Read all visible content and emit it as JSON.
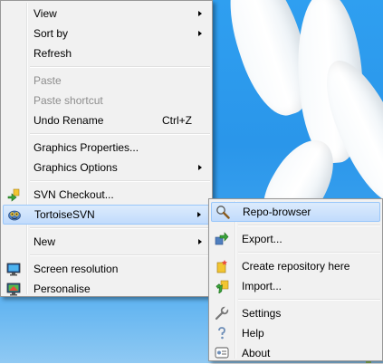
{
  "context_menu": {
    "items": [
      {
        "label": "View",
        "submenu": true
      },
      {
        "label": "Sort by",
        "submenu": true
      },
      {
        "label": "Refresh"
      },
      {
        "label": "Paste",
        "disabled": true
      },
      {
        "label": "Paste shortcut",
        "disabled": true
      },
      {
        "label": "Undo Rename",
        "shortcut": "Ctrl+Z"
      },
      {
        "label": "Graphics Properties..."
      },
      {
        "label": "Graphics Options",
        "submenu": true
      },
      {
        "label": "SVN Checkout...",
        "icon": "svn-checkout-icon"
      },
      {
        "label": "TortoiseSVN",
        "icon": "tortoisesvn-icon",
        "submenu": true,
        "highlighted": true
      },
      {
        "label": "New",
        "submenu": true
      },
      {
        "label": "Screen resolution",
        "icon": "screen-resolution-icon"
      },
      {
        "label": "Personalise",
        "icon": "personalise-icon"
      }
    ]
  },
  "tortoisesvn_submenu": {
    "items": [
      {
        "label": "Repo-browser",
        "icon": "repo-browser-icon",
        "highlighted": true
      },
      {
        "label": "Export...",
        "icon": "export-icon"
      },
      {
        "label": "Create repository here",
        "icon": "create-repository-icon"
      },
      {
        "label": "Import...",
        "icon": "import-icon"
      },
      {
        "label": "Settings",
        "icon": "settings-icon"
      },
      {
        "label": "Help",
        "icon": "help-icon"
      },
      {
        "label": "About",
        "icon": "about-icon"
      }
    ]
  },
  "colors": {
    "desktop_blue": "#2a96ea",
    "menu_bg": "#f1f1f1",
    "highlight_bg": "#c1dbfc",
    "highlight_border": "#99c7fa"
  }
}
